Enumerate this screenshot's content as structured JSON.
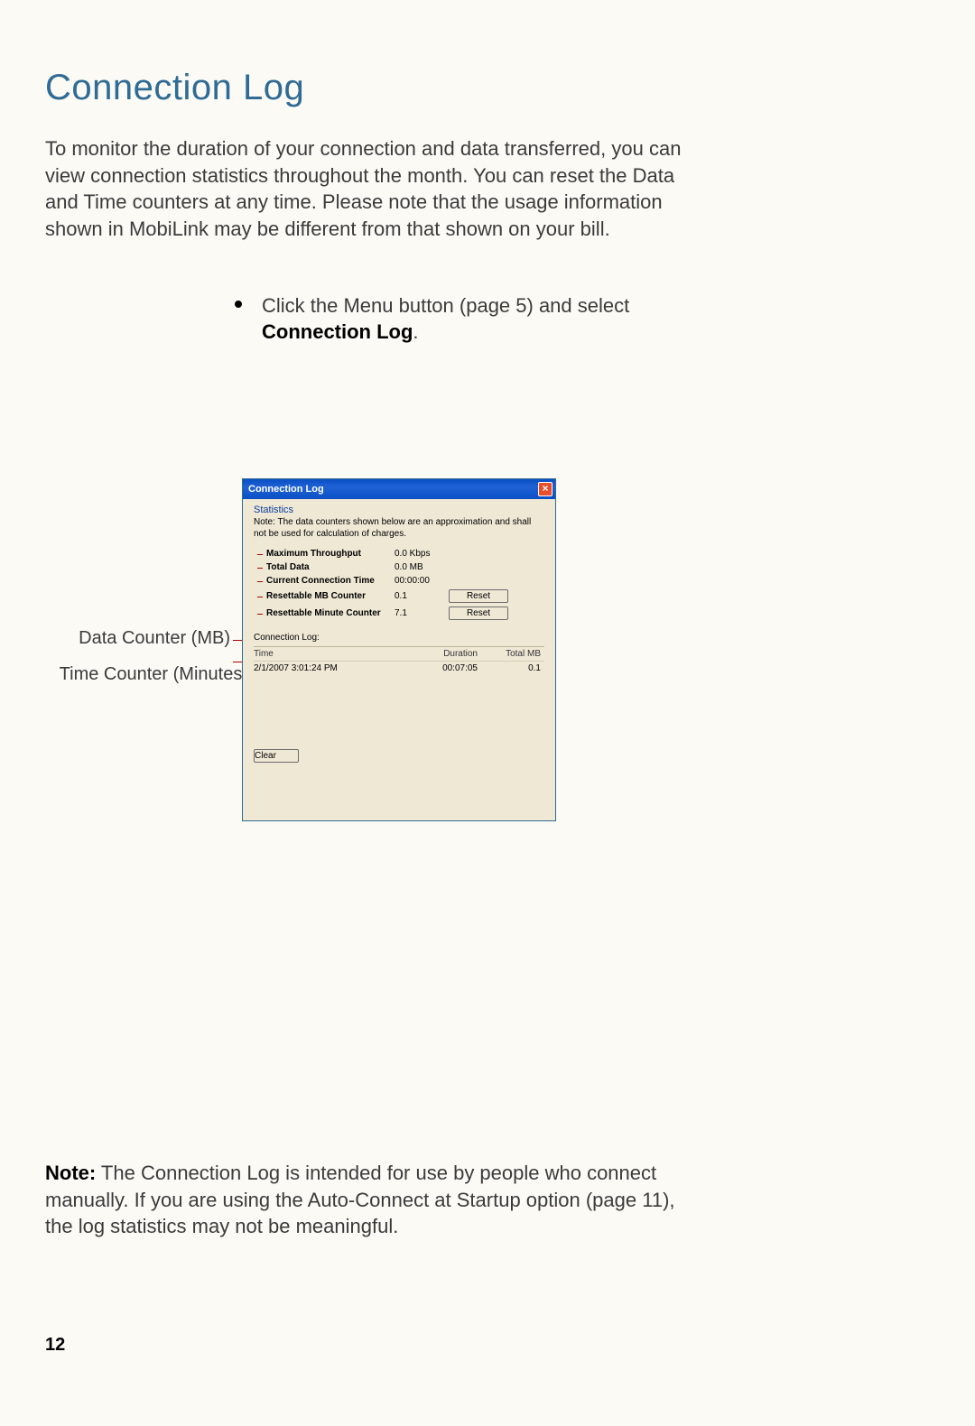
{
  "page": {
    "title": "Connection Log",
    "intro": "To monitor the duration of your connection and data transferred, you can view connection statistics throughout the month. You can reset the Data and Time counters at any time. Please note that the usage information shown in MobiLink may be different from that shown on your bill.",
    "bullet_prefix": "Click the Menu button (page 5) and select ",
    "bullet_bold": "Connection Log",
    "bullet_suffix": ".",
    "note_label": "Note:",
    "note_text": " The Connection Log is intended for use by people who connect manually. If you are using the Auto-Connect at Startup option (page 11), the log statistics may not be meaningful.",
    "page_number": "12",
    "annot_data": "Data Counter (MB)",
    "annot_time": "Time Counter (Minutes)"
  },
  "dialog": {
    "title": "Connection Log",
    "close_glyph": "×",
    "stats_heading": "Statistics",
    "stats_note": "Note: The data counters shown below are an approximation and shall not be used for calculation of charges.",
    "rows": {
      "max_throughput": {
        "label": "Maximum Throughput",
        "value": "0.0 Kbps"
      },
      "total_data": {
        "label": "Total Data",
        "value": "0.0 MB"
      },
      "conn_time": {
        "label": "Current Connection Time",
        "value": "00:00:00"
      },
      "mb_counter": {
        "label": "Resettable MB Counter",
        "value": "0.1"
      },
      "min_counter": {
        "label": "Resettable Minute Counter",
        "value": "7.1"
      }
    },
    "reset_label": "Reset",
    "conn_log_label": "Connection Log:",
    "table": {
      "headers": {
        "time": "Time",
        "duration": "Duration",
        "total_mb": "Total MB"
      },
      "row": {
        "time": "2/1/2007 3:01:24 PM",
        "duration": "00:07:05",
        "total_mb": "0.1"
      }
    },
    "clear_label": "Clear"
  }
}
